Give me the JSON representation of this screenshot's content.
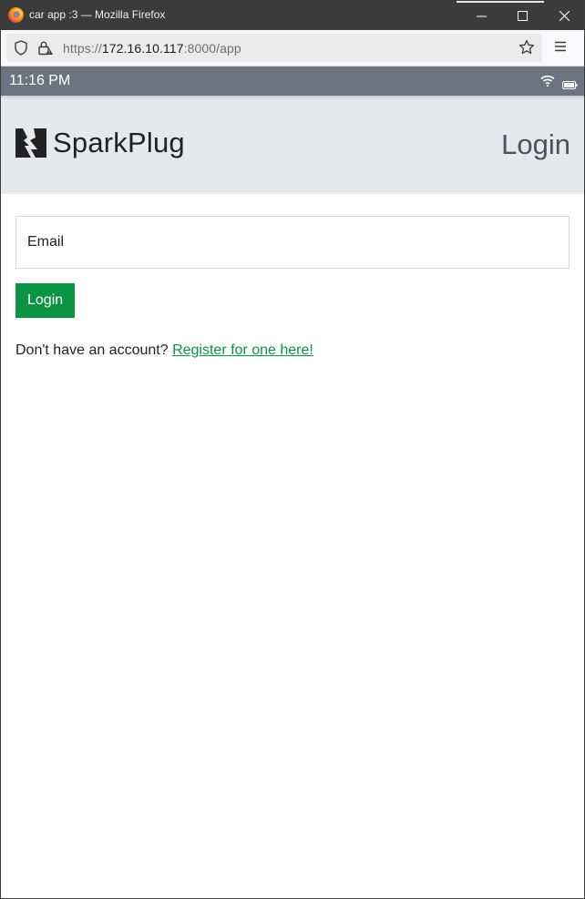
{
  "browser": {
    "window_title": "car app :3 — Mozilla Firefox",
    "url_scheme": "https://",
    "url_host": "172.16.10.117",
    "url_rest": ":8000/app",
    "icons": {
      "logo": "firefox-logo-icon",
      "minimize": "minimize-icon",
      "maximize": "maximize-icon",
      "close": "close-icon",
      "shield": "shield-icon",
      "lock": "lock-icon",
      "bookmark": "star-icon",
      "menu": "hamburger-menu-icon"
    }
  },
  "statusbar": {
    "time": "11:16 PM",
    "icons": {
      "wifi": "wifi-icon",
      "battery": "battery-icon"
    }
  },
  "header": {
    "brand_name": "SparkPlug",
    "page_title": "Login"
  },
  "form": {
    "email_placeholder": "Email",
    "email_value": "",
    "login_label": "Login",
    "register_prompt": "Don't have an account? ",
    "register_link": "Register for one here!"
  },
  "colors": {
    "accent_green": "#0b9444",
    "header_bg": "#e6e9ec",
    "statusbar_bg": "#6b7480",
    "titlebar_bg": "#3b3b3b"
  }
}
